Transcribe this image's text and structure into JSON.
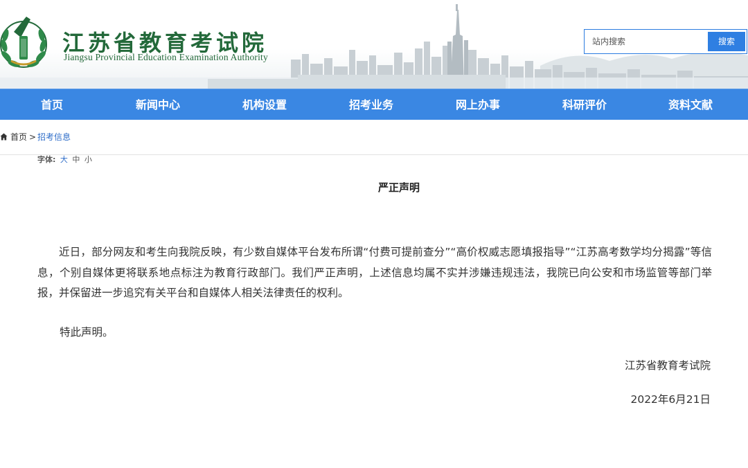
{
  "header": {
    "org_name_cn": "江苏省教育考试院",
    "org_name_en": "Jiangsu Provincial Education Examination Authority",
    "logo_icon": "emblem-icon",
    "brand_color": "#23693a",
    "search": {
      "placeholder": "站内搜索",
      "value": "",
      "button_label": "搜索"
    }
  },
  "nav": {
    "color": "#3a87e3",
    "items": [
      {
        "label": "首页"
      },
      {
        "label": "新闻中心"
      },
      {
        "label": "机构设置"
      },
      {
        "label": "招考业务"
      },
      {
        "label": "网上办事"
      },
      {
        "label": "科研评价"
      },
      {
        "label": "资料文献"
      }
    ]
  },
  "breadcrumb": {
    "icon": "home-icon",
    "home": "首页",
    "separator": ">",
    "current": "招考信息"
  },
  "font_tool": {
    "label": "字体:",
    "options": [
      "大",
      "中",
      "小"
    ],
    "selected": "大"
  },
  "article": {
    "title": "严正声明",
    "paragraphs": [
      "近日，部分网友和考生向我院反映，有少数自媒体平台发布所谓“付费可提前查分”“高价权威志愿填报指导”“江苏高考数学均分揭露”等信息，个别自媒体更将联系地点标注为教育行政部门。我们严正声明，上述信息均属不实并涉嫌违规违法，我院已向公安和市场监管等部门举报，并保留进一步追究有关平台和自媒体人相关法律责任的权利。",
      "特此声明。"
    ],
    "signature": "江苏省教育考试院",
    "date": "2022年6月21日"
  }
}
